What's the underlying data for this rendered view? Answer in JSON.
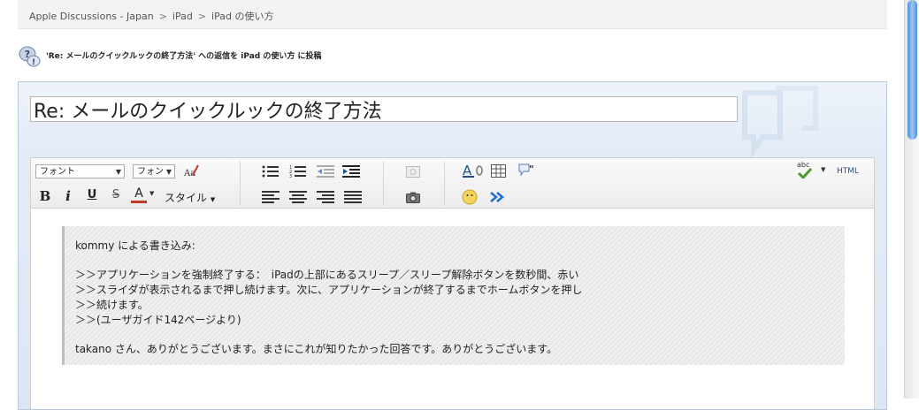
{
  "breadcrumb": [
    "Apple Discussions - Japan",
    "iPad",
    "iPad の使い方"
  ],
  "breadcrumb_separator": ">",
  "post_heading": "'Re: メールのクイックルックの終了方法' への返信を iPad の使い方 に投稿",
  "subject": {
    "value": "Re: メールのクイックルックの終了方法"
  },
  "toolbar": {
    "font_select": "フォント",
    "size_select": "フォン",
    "bold": "B",
    "italic": "i",
    "underline": "U",
    "strike": "S",
    "text_color": "A",
    "style_menu": "スタイル",
    "html_button": "HTML",
    "spell_label": "abc"
  },
  "quote": {
    "author_line": "kommy による書き込み:",
    "lines": [
      "＞＞アプリケーションを強制終了する：　iPadの上部にあるスリープ／スリープ解除ボタンを数秒間、赤い",
      "＞＞スライダが表示されるまで押し続けます。次に、アプリケーションが終了するまでホームボタンを押し",
      "＞＞続けます。",
      "＞＞(ユーザガイド142ページより)"
    ],
    "reply": "takano さん、ありがとうございます。まさにこれが知りたかった回答です。ありがとうございます。"
  },
  "colors": {
    "accent": "#1f4f8a",
    "scroll_thumb": "#5a9be0"
  }
}
